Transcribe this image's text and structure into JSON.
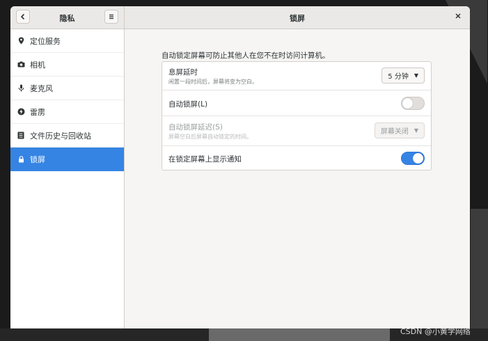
{
  "titlebar": {
    "left_title": "隐私",
    "main_title": "锁屏",
    "back_icon": "chevron-left-icon",
    "menu_icon": "hamburger-icon",
    "close_icon": "close-icon"
  },
  "sidebar": {
    "items": [
      {
        "label": "定位服务",
        "icon": "location-pin-icon"
      },
      {
        "label": "相机",
        "icon": "camera-icon"
      },
      {
        "label": "麦克风",
        "icon": "microphone-icon"
      },
      {
        "label": "雷雳",
        "icon": "thunderbolt-icon"
      },
      {
        "label": "文件历史与回收站",
        "icon": "file-history-icon"
      },
      {
        "label": "锁屏",
        "icon": "lock-icon",
        "active": true
      }
    ]
  },
  "main": {
    "description": "自动锁定屏幕可防止其他人在您不在时访问计算机。",
    "blank_delay": {
      "title": "息屏延时",
      "subtitle": "闲置一段时间后，屏幕将变为空白。",
      "value": "5 分钟"
    },
    "auto_lock": {
      "title": "自动锁屏(L)",
      "enabled": false
    },
    "auto_lock_delay": {
      "title": "自动锁屏延迟(S)",
      "subtitle": "屏幕空白后屏幕自动锁定的时间。",
      "value": "屏幕关闭",
      "disabled": true
    },
    "show_notifications": {
      "title": "在锁定屏幕上显示通知",
      "enabled": true
    }
  },
  "colors": {
    "accent": "#3584e4",
    "window_bg": "#f6f5f4",
    "sidebar_bg": "#ffffff",
    "titlebar_bg": "#ebe9e7"
  },
  "watermark": "CSDN @小黄学网络"
}
